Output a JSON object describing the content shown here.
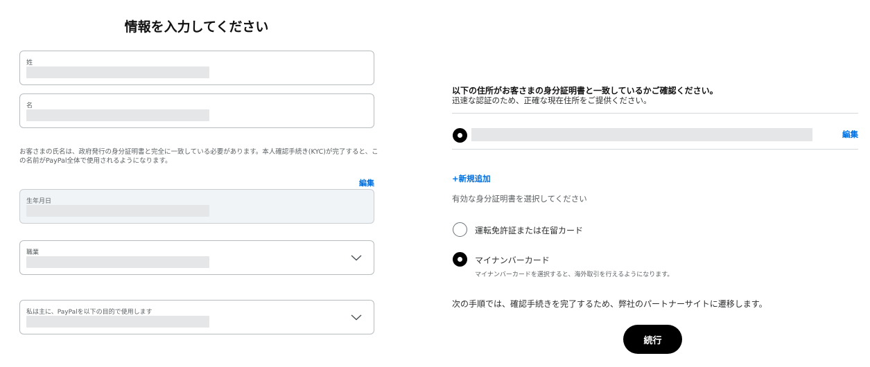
{
  "page": {
    "title": "情報を入力してください"
  },
  "form": {
    "last_name_label": "姓",
    "first_name_label": "名",
    "name_note": "お客さまの氏名は、政府発行の身分証明書と完全に一致している必要があります。本人確認手続き(KYC)が完了すると、この名前がPayPal全体で使用されるようになります。",
    "edit_label": "編集",
    "dob_label": "生年月日",
    "occupation_label": "職業",
    "purpose_label": "私は主に、PayPalを以下の目的で使用します"
  },
  "address": {
    "heading": "以下の住所がお客さまの身分証明書と一致しているかご確認ください。",
    "subheading": "迅速な認証のため、正確な現在住所をご提供ください。",
    "edit_label": "編集",
    "add_new_label": "+新規追加"
  },
  "id_selection": {
    "prompt": "有効な身分証明書を選択してください",
    "options": [
      {
        "label": "運転免許証または在留カード",
        "selected": false
      },
      {
        "label": "マイナンバーカード",
        "selected": true,
        "hint": "マイナンバーカードを選択すると、海外取引を行えるようになります。"
      }
    ]
  },
  "footer": {
    "next_note": "次の手順では、確認手続きを完了するため、弊社のパートナーサイトに遷移します。",
    "continue_label": "続行"
  },
  "colors": {
    "link": "#0070e0",
    "button": "#000000",
    "border": "#b7bcbf",
    "placeholder": "#e4e6e8"
  }
}
